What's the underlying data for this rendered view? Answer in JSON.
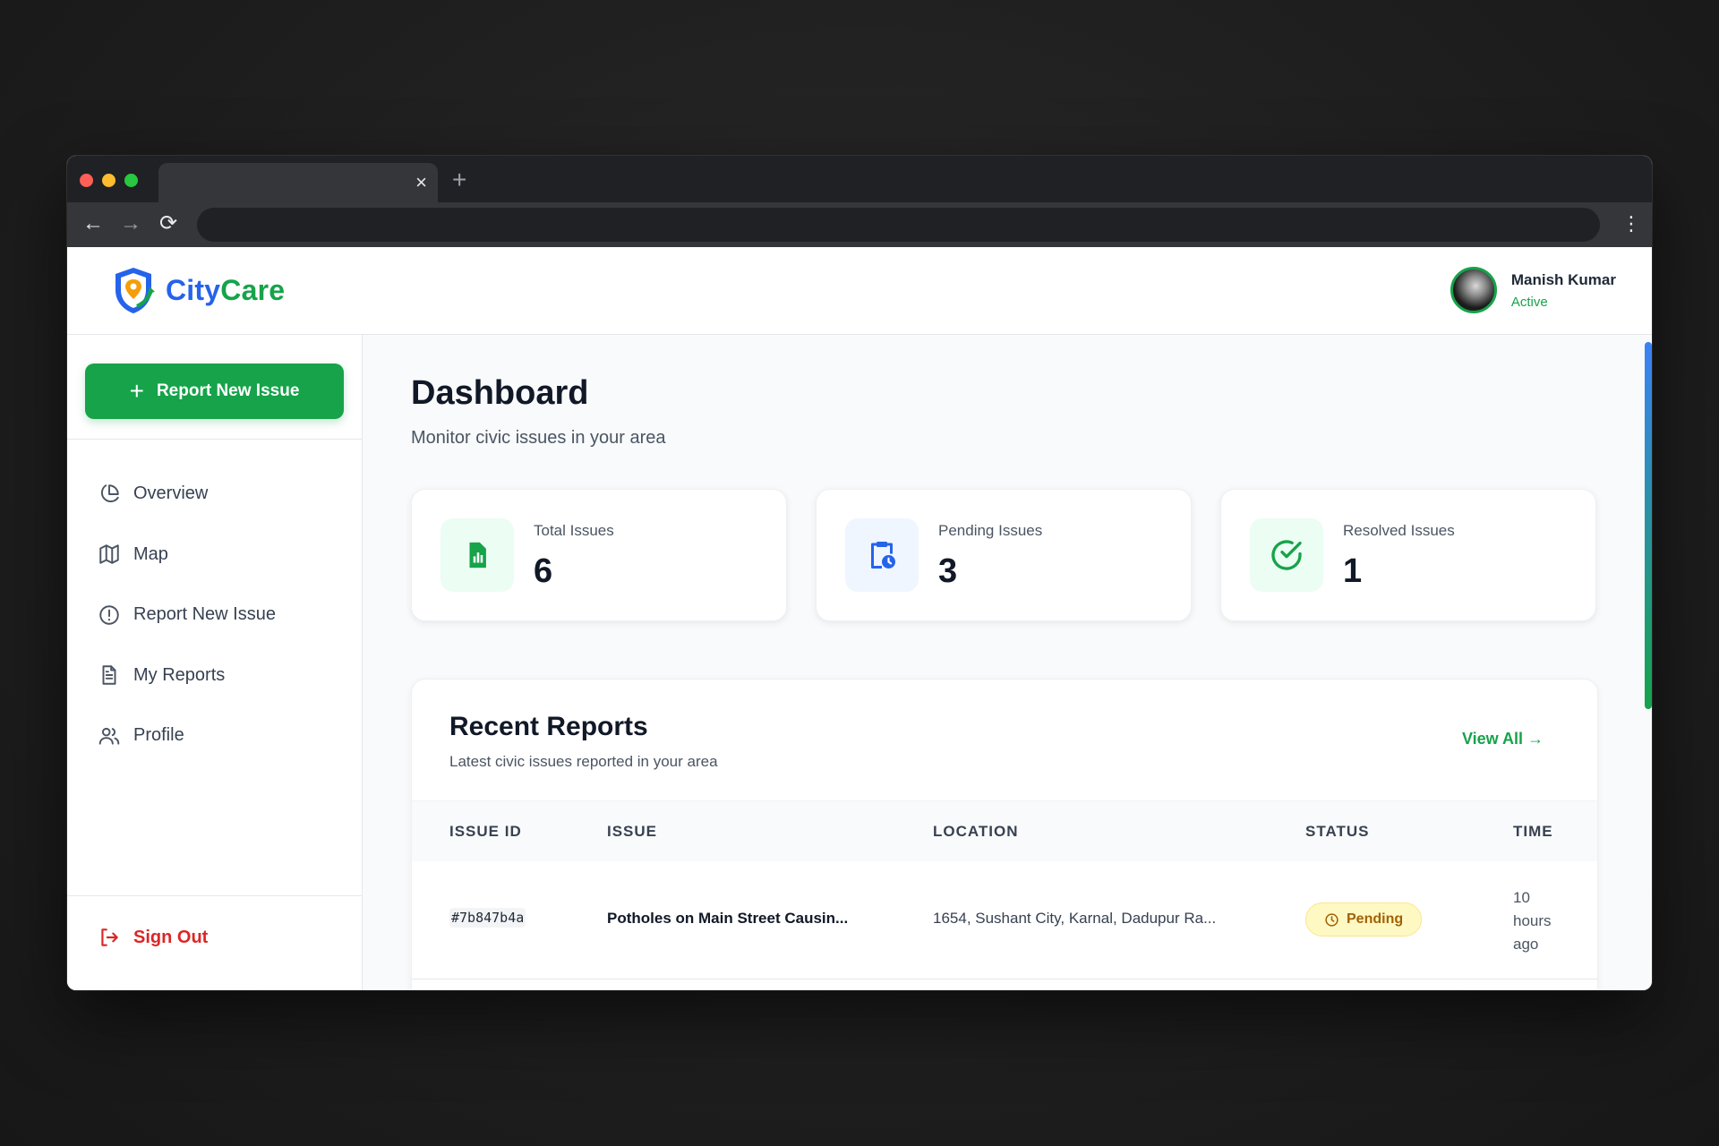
{
  "browser": {
    "tab_close": "×",
    "tab_new": "+",
    "back": "←",
    "forward": "→",
    "reload": "⟳",
    "menu": "⋮"
  },
  "app": {
    "logo": {
      "city": "City",
      "care": "Care",
      "icon": "shield-location-icon"
    },
    "user": {
      "name": "Manish Kumar",
      "status": "Active"
    }
  },
  "sidebar": {
    "report_button": {
      "icon": "+",
      "label": "Report New Issue"
    },
    "items": [
      {
        "label": "Overview",
        "icon": "pie-chart-icon"
      },
      {
        "label": "Map",
        "icon": "map-icon"
      },
      {
        "label": "Report New Issue",
        "icon": "alert-circle-icon"
      },
      {
        "label": "My Reports",
        "icon": "file-text-icon"
      },
      {
        "label": "Profile",
        "icon": "users-icon"
      }
    ],
    "sign_out": "Sign Out"
  },
  "main": {
    "title": "Dashboard",
    "subtitle": "Monitor civic issues in your area",
    "stats": [
      {
        "label": "Total Issues",
        "value": "6",
        "icon": "spreadsheet-icon",
        "color": "#16a34a"
      },
      {
        "label": "Pending Issues",
        "value": "3",
        "icon": "clipboard-clock-icon",
        "color": "#2563eb"
      },
      {
        "label": "Resolved Issues",
        "value": "1",
        "icon": "check-circle-icon",
        "color": "#16a34a"
      }
    ],
    "recent": {
      "title": "Recent Reports",
      "subtitle": "Latest civic issues reported in your area",
      "view_all": "View All →",
      "columns": [
        "ISSUE ID",
        "ISSUE",
        "LOCATION",
        "STATUS",
        "TIME"
      ],
      "rows": [
        {
          "id": "#7b847b4a",
          "issue": "Potholes on Main Street Causin...",
          "location": "1654, Sushant City, Karnal, Dadupur Ra...",
          "status": "Pending",
          "time": "10 hours ago"
        }
      ]
    }
  },
  "colors": {
    "primary_green": "#16a34a",
    "primary_blue": "#2563eb",
    "danger": "#dc2626",
    "pending_bg": "#fef9c3",
    "pending_text": "#a16207"
  }
}
